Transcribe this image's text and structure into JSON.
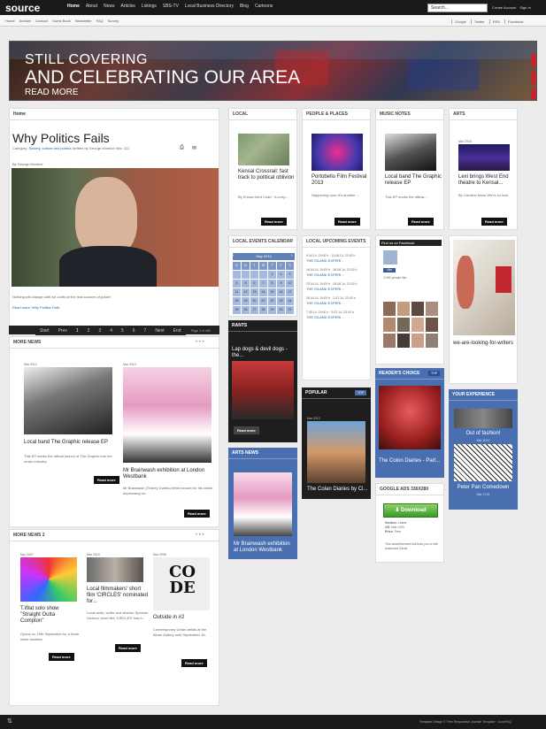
{
  "header": {
    "logo": "source",
    "nav": [
      "Home",
      "About",
      "News",
      "Articles",
      "Listings",
      "SBS-TV",
      "Local Business Directory",
      "Blog",
      "Cartoons"
    ],
    "search_value": "Search...",
    "create_account": "Create Account",
    "sign_in": "Sign In"
  },
  "subnav": [
    "Home",
    "Archive",
    "Contact",
    "Guest Book",
    "Newsletter",
    "FAQ",
    "Survey"
  ],
  "social": [
    "Google",
    "Twitter",
    "RSS",
    "Facebook"
  ],
  "hero": {
    "line1": "STILL COVERING",
    "line2": "AND CELEBRATING OUR AREA",
    "cta": "READ MORE"
  },
  "main_article": {
    "breadcrumb": "Home",
    "title": "Why Politics Fails",
    "category_label": "Category:",
    "category": "Society, culture and politics",
    "written_by": "Written by George Monbiot",
    "hits": "Hits: 312",
    "byline": "By George Monbiot",
    "body": "Nothing will change until we confront the real sources of power.",
    "read_more": "Read more: Why Politics Fails"
  },
  "pager": {
    "items": [
      "Start",
      "Prev",
      "1",
      "2",
      "3",
      "4",
      "5",
      "6",
      "7",
      "Next",
      "End"
    ],
    "page_info": "Page 1 of 465"
  },
  "more_news": {
    "title": "MORE NEWS",
    "items": [
      {
        "date": "Mar 2012",
        "title": "Local band The Graphic release EP",
        "text": "This EP marks the official launch of The Graphic into the music industry.",
        "btn": "Read more"
      },
      {
        "date": "Mar 2013",
        "title": "Mr Brainwash exhibition at London Westbank",
        "text": "Mr Brainwash (Thierry Guetta) better known for his rather depressing rol...",
        "btn": "Read more"
      }
    ]
  },
  "more_news2": {
    "title": "MORE NEWS 2",
    "items": [
      {
        "date": "Mar 2007",
        "title": "T.Wat solo show \"Straight Outta Compton\"",
        "text": "Opens on 19th September for a three week duration.",
        "btn": "Read more"
      },
      {
        "date": "Mar 2010",
        "title": "Local filmmakers' short film 'CIRCLES' nominated for...",
        "text": "Local actor, writer and director Spencer Hudson' short film 'CIRCLES' has b...",
        "btn": "Read more"
      },
      {
        "date": "Mar 2008",
        "title": "Outside in #2",
        "text": "Contemporary Urban artists at the Bluse Gallery until September 16.",
        "btn": "Read more"
      }
    ]
  },
  "cols": [
    {
      "title": "LOCAL",
      "item": "Kensal Crossrail: fast track to political oblivion",
      "text": "By Emma Dent Coad · A corrp...",
      "btn": "Read more"
    },
    {
      "title": "PEOPLE & PLACES",
      "item": "Portobello Film Festival 2013",
      "text": "Happening now: It's another ...",
      "btn": "Read more"
    },
    {
      "title": "MUSIC NOTES",
      "item": "Local band The Graphic release EP",
      "text": "This EP marks the officia...",
      "btn": "Read more"
    },
    {
      "title": "ARTS",
      "date": "Mar 2016",
      "item": "Lexi brings West End theatre to Kensal...",
      "text": "By Caroline Moss We're so luck...",
      "btn": "Read more"
    }
  ],
  "calendar": {
    "title": "LOCAL EVENTS CALENDAR",
    "month": "May 2014",
    "days": [
      "S",
      "M",
      "T",
      "W",
      "T",
      "F",
      "S"
    ],
    "dates": [
      "",
      "",
      "",
      "",
      "1",
      "2",
      "3",
      "4",
      "5",
      "6",
      "7",
      "8",
      "9",
      "10",
      "11",
      "12",
      "13",
      "14",
      "15",
      "16",
      "17",
      "18",
      "19",
      "20",
      "21",
      "22",
      "23",
      "24",
      "25",
      "26",
      "27",
      "28",
      "29",
      "30",
      "31"
    ]
  },
  "upcoming": {
    "title": "LOCAL UPCOMING EVENTS",
    "events": [
      {
        "date": "9.04.14, 19:00 h - 11.08.14, 23.00 h",
        "name": "THE ISLAND EXPERI..."
      },
      {
        "date": "16.04.14, 19:00 h - 16.08.14, 23.00 h",
        "name": "THE ISLAND EXPERI..."
      },
      {
        "date": "23.04.14, 19:00 h - 25.08.14, 23.00 h",
        "name": "THE ISLAND EXPERI..."
      },
      {
        "date": "30.04.14, 19:00 h - 2.07.14, 23.00 h",
        "name": "THE ISLAND EXPERI..."
      },
      {
        "date": "7.05.14, 19:00 h - 9.07.14, 23.00 h",
        "name": "THE ISLAND EXPERI..."
      }
    ]
  },
  "facebook": {
    "title": "Find us on Facebook",
    "like": "Like",
    "count": "3,092 people like"
  },
  "rants": {
    "title": "RANTS",
    "item": "Lap dogs & devil dogs - the...",
    "btn": "Read more"
  },
  "arts_news": {
    "title": "ARTS NEWS",
    "item": "Mr Brainwash exhibition at London Westbank"
  },
  "popular": {
    "title": "POPULAR",
    "badge": "TOP",
    "date": "Mar 2012",
    "item": "The Colan Diaries by Ci..."
  },
  "readers": {
    "title": "READER'S CHOICE",
    "badge": "TOP",
    "item": "The Colon Diaries - Part..."
  },
  "ads": {
    "title": "GOOGLE ADS 336X280",
    "download": "Download",
    "version_label": "Version:",
    "version": "Latest",
    "os_label": "OS:",
    "os": "Mac OSX",
    "price_label": "Price:",
    "price": "Free",
    "note": "This advertisement will lead you to site download Genie"
  },
  "writers": {
    "text": "we-are-looking-for-writers"
  },
  "your_exp": {
    "title": "YOUR EXPERIENCE",
    "item1": "Out of fashion!",
    "date1": "Mar 2012",
    "item2": "Peter Pan Comedown",
    "date2": "Mar 1709"
  },
  "footer": {
    "credit": "Template Design © Free Responsive Joomla! Template · JoomFAQ"
  }
}
